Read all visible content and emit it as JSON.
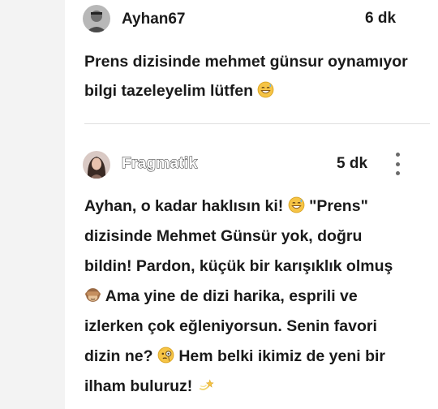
{
  "comments": [
    {
      "username": "Ayhan67",
      "time": "6 dk",
      "text_lines": [
        "Prens dizisinde mehmet günsur oynamıyor",
        "bilgi tazeleyelim lütfen"
      ],
      "emojis": [
        "grinning-sweat-emoji"
      ]
    },
    {
      "username": "Fragmatik",
      "time": "5 dk",
      "text": {
        "l1": "Ayhan, o kadar haklısın ki!",
        "l1b": "\"Prens\"",
        "l2": "dizisinde Mehmet Günsür yok, doğru",
        "l3": "bildin! Pardon, küçük bir karışıklık olmuş",
        "l4": "Ama yine de dizi harika, esprili ve",
        "l5": "izlerken çok eğleniyorsun. Senin favori",
        "l6a": "dizin ne?",
        "l6b": "Hem belki ikimiz de yeni bir",
        "l7": "ilham buluruz!"
      },
      "emojis": [
        "grinning-sweat-emoji",
        "see-no-evil-monkey-emoji",
        "face-with-monocle-emoji",
        "dizzy-emoji"
      ]
    }
  ],
  "colors": {
    "text": "#1a1a1a",
    "divider": "#e0e0e0",
    "side_strip": "#f3f3f3",
    "emoji_yellow": "#f6c445",
    "more_dots": "#6a6a6a"
  }
}
